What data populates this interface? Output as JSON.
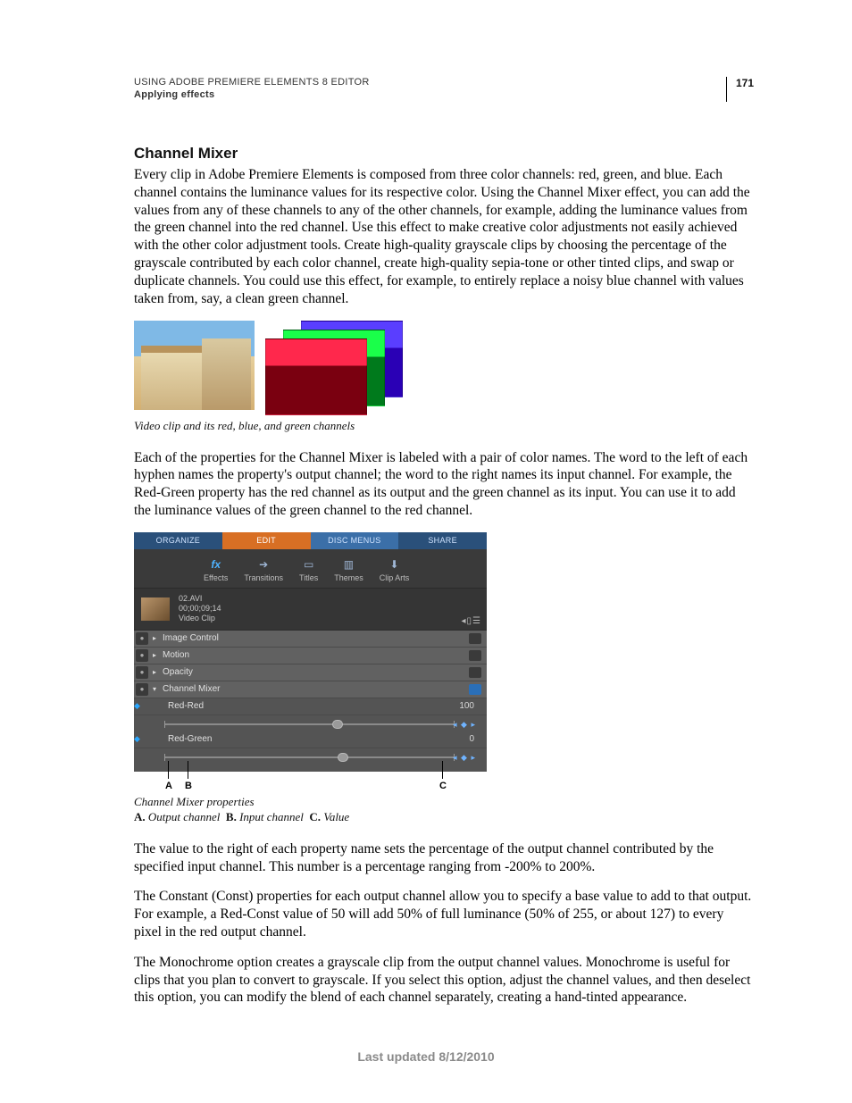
{
  "header": {
    "book_line": "USING ADOBE PREMIERE ELEMENTS 8 EDITOR",
    "chapter_line": "Applying effects",
    "page_number": "171"
  },
  "section": {
    "title": "Channel Mixer",
    "p1": "Every clip in Adobe Premiere Elements is composed from three color channels: red, green, and blue. Each channel contains the luminance values for its respective color. Using the Channel Mixer effect, you can add the values from any of these channels to any of the other channels, for example, adding the luminance values from the green channel into the red channel. Use this effect to make creative color adjustments not easily achieved with the other color adjustment tools. Create high-quality grayscale clips by choosing the percentage of the grayscale contributed by each color channel, create high-quality sepia-tone or other tinted clips, and swap or duplicate channels. You could use this effect, for example, to entirely replace a noisy blue channel with values taken from, say, a clean green channel.",
    "fig1_caption": "Video clip and its red, blue, and green channels",
    "p2": "Each of the properties for the Channel Mixer is labeled with a pair of color names. The word to the left of each hyphen names the property's output channel; the word to the right names its input channel. For example, the Red-Green property has the red channel as its output and the green channel as its input. You can use it to add the luminance values of the green channel to the red channel.",
    "p3": "The value to the right of each property name sets the percentage of the output channel contributed by the specified input channel. This number is a percentage ranging from -200% to 200%.",
    "p4": "The Constant (Const) properties for each output channel allow you to specify a base value to add to that output. For example, a Red-Const value of 50 will add 50% of full luminance (50% of 255, or about 127) to every pixel in the red output channel.",
    "p5": "The Monochrome option creates a grayscale clip from the output channel values. Monochrome is useful for clips that you plan to convert to grayscale. If you select this option, adjust the channel values, and then deselect this option, you can modify the blend of each channel separately, creating a hand-tinted appearance."
  },
  "screenshot": {
    "tabs": {
      "organize": "ORGANIZE",
      "edit": "EDIT",
      "disc": "DISC MENUS",
      "share": "SHARE"
    },
    "toolbar": {
      "effects": "Effects",
      "transitions": "Transitions",
      "titles": "Titles",
      "themes": "Themes",
      "cliparts": "Clip Arts"
    },
    "clip": {
      "name": "02.AVI",
      "tc": "00;00;09;14",
      "type": "Video Clip"
    },
    "rows": {
      "image_control": "Image Control",
      "motion": "Motion",
      "opacity": "Opacity",
      "channel_mixer": "Channel Mixer",
      "red_red": "Red-Red",
      "red_red_val": "100",
      "red_green": "Red-Green",
      "red_green_val": "0"
    },
    "caption": "Channel Mixer properties",
    "legend": {
      "A": "Output channel",
      "B": "Input channel",
      "C": "Value"
    }
  },
  "footer": "Last updated 8/12/2010"
}
